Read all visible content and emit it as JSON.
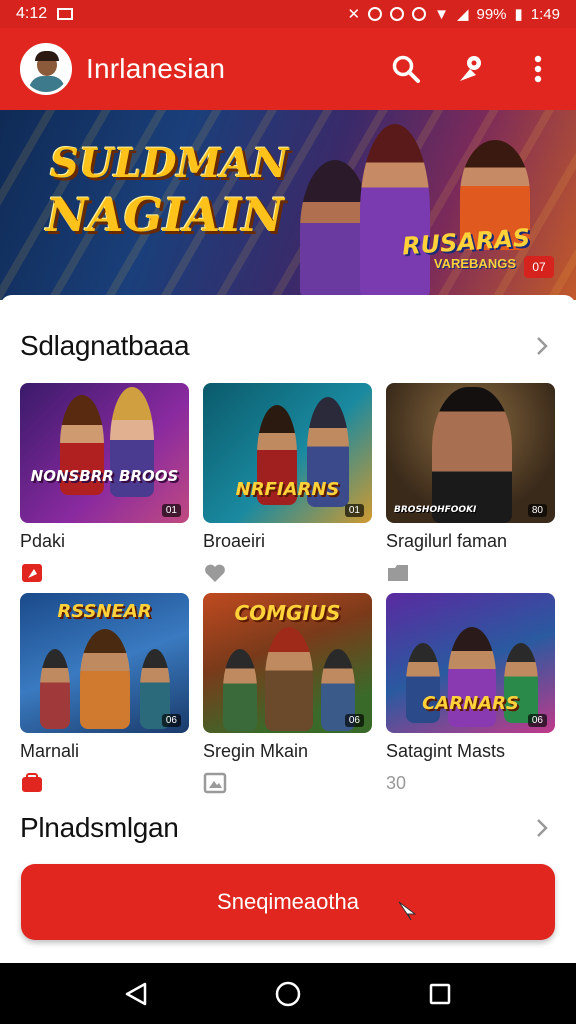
{
  "status_bar": {
    "time": "4:12",
    "battery": "99%",
    "clock_right": "1:49"
  },
  "app_bar": {
    "title": "Inrlanesian"
  },
  "banner": {
    "title_line1": "SULDMAN",
    "title_line2": "NAGIAIN",
    "logo_line1": "RUSARAS",
    "logo_line2": "VAREBANGS",
    "badge": "07"
  },
  "section1": {
    "title": "Sdlagnatbaaa",
    "cards": [
      {
        "label": "Pdaki",
        "art_title": "NONSBRR BROOS",
        "badge": "01",
        "meta_icon": "red-flag-icon",
        "meta_color": "#e0261f",
        "theme": "purple"
      },
      {
        "label": "Broaeiri",
        "art_title": "NRFIARNS",
        "badge": "01",
        "meta_icon": "heart-icon",
        "meta_color": "#9a9a9a",
        "theme": "teal"
      },
      {
        "label": "Sragilurl faman",
        "art_title": "BROSHOHFOOKI",
        "badge": "80",
        "meta_icon": "folder-icon",
        "meta_color": "#9a9a9a",
        "theme": "portrait"
      },
      {
        "label": "Marnali",
        "art_title": "RSSNEAR",
        "badge": "06",
        "meta_icon": "red-bag-icon",
        "meta_color": "#e0261f",
        "theme": "blue"
      },
      {
        "label": "Sregin Mkain",
        "art_title": "COMGIUS",
        "badge": "06",
        "meta_icon": "image-icon",
        "meta_color": "#9a9a9a",
        "theme": "green"
      },
      {
        "label": "Satagint Masts",
        "art_title": "CARNARS",
        "badge": "06",
        "meta_text": "30",
        "theme": "violet"
      }
    ]
  },
  "section2": {
    "title": "Plnadsmlgan"
  },
  "cta": {
    "label": "Sneqimeaotha"
  },
  "colors": {
    "brand": "#e0261f",
    "status_bar": "#d7231e",
    "nav": "#000000"
  }
}
